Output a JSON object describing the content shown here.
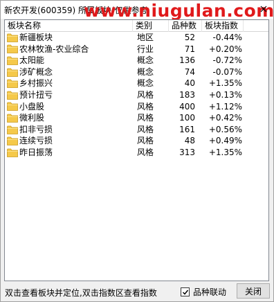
{
  "window": {
    "title": "新农开发(600359)   所属板块(仅供参考",
    "watermark": "www.niugulan.com"
  },
  "table": {
    "headers": [
      "板块名称",
      "类别",
      "品种数",
      "板块指数"
    ],
    "rows": [
      {
        "name": "新疆板块",
        "type": "地区",
        "count": "52",
        "index": "-0.44%"
      },
      {
        "name": "农林牧渔-农业综合",
        "type": "行业",
        "count": "71",
        "index": "+0.20%"
      },
      {
        "name": "太阳能",
        "type": "概念",
        "count": "136",
        "index": "-0.72%"
      },
      {
        "name": "涉矿概念",
        "type": "概念",
        "count": "74",
        "index": "-0.07%"
      },
      {
        "name": "乡村振兴",
        "type": "概念",
        "count": "40",
        "index": "+1.35%"
      },
      {
        "name": "预计扭亏",
        "type": "风格",
        "count": "183",
        "index": "+0.13%"
      },
      {
        "name": "小盘股",
        "type": "风格",
        "count": "400",
        "index": "+1.12%"
      },
      {
        "name": "微利股",
        "type": "风格",
        "count": "100",
        "index": "+0.42%"
      },
      {
        "name": "扣非亏损",
        "type": "风格",
        "count": "161",
        "index": "+0.56%"
      },
      {
        "name": "连续亏损",
        "type": "风格",
        "count": "48",
        "index": "+0.49%"
      },
      {
        "name": "昨日振荡",
        "type": "风格",
        "count": "313",
        "index": "+1.35%"
      }
    ]
  },
  "status": {
    "hint": "双击查看板块并定位,双击指数区查看指数",
    "checkbox_label": "品种联动",
    "checkbox_checked": true,
    "close_label": "关闭"
  },
  "icons": {
    "row_icon": "folder-icon",
    "title_close": "close-icon",
    "check": "checkmark-icon"
  },
  "colors": {
    "watermark": "#e0191b",
    "folder": "#f5c94a"
  }
}
